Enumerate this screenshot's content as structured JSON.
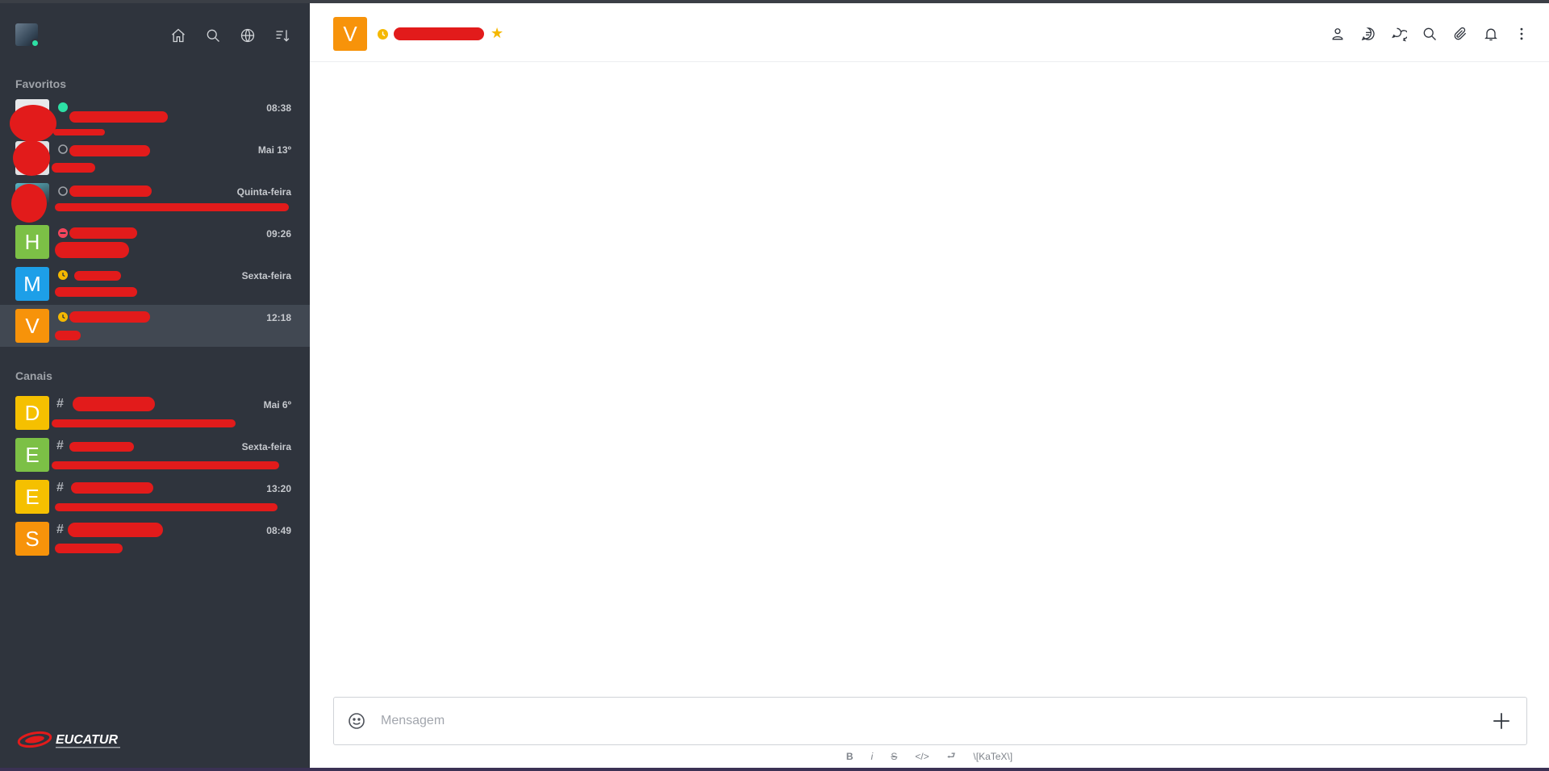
{
  "sidebar": {
    "tools": [
      {
        "icon": "home-icon"
      },
      {
        "icon": "search-icon"
      },
      {
        "icon": "directory-icon"
      },
      {
        "icon": "sort-icon"
      }
    ],
    "favorites_title": "Favoritos",
    "favorites": [
      {
        "avatar_letter": "",
        "status": "online",
        "name": "",
        "time": "08:38",
        "message": ""
      },
      {
        "avatar_letter": "",
        "status": "offline",
        "name": "",
        "time": "Mai 13º",
        "message": ""
      },
      {
        "avatar_letter": "",
        "status": "offline",
        "name": "",
        "time": "Quinta-feira",
        "message": ""
      },
      {
        "avatar_letter": "H",
        "status": "busy",
        "name": "",
        "time": "09:26",
        "message": ""
      },
      {
        "avatar_letter": "M",
        "status": "away",
        "name": "",
        "time": "Sexta-feira",
        "message": ""
      },
      {
        "avatar_letter": "V",
        "status": "away",
        "name": "",
        "time": "12:18",
        "message": ""
      }
    ],
    "channels_title": "Canais",
    "channels": [
      {
        "avatar_letter": "D",
        "name": "",
        "time": "Mai 6º",
        "message": ""
      },
      {
        "avatar_letter": "E",
        "name": "",
        "time": "Sexta-feira",
        "message": ""
      },
      {
        "avatar_letter": "E",
        "name": "",
        "time": "13:20",
        "message": ""
      },
      {
        "avatar_letter": "S",
        "name": "",
        "time": "08:49",
        "message": ""
      }
    ],
    "logo_text": "EUCATUR"
  },
  "room": {
    "avatar_letter": "V",
    "title": "",
    "header_tools": [
      {
        "icon": "user-info-icon"
      },
      {
        "icon": "discussion-icon"
      },
      {
        "icon": "threads-icon"
      },
      {
        "icon": "search-icon"
      },
      {
        "icon": "attachment-icon"
      },
      {
        "icon": "bell-icon"
      },
      {
        "icon": "kebab-menu-icon"
      }
    ]
  },
  "composer": {
    "placeholder": "Mensagem",
    "format": {
      "bold": "B",
      "italic": "i",
      "strike": "S",
      "code": "</>",
      "multiline": "⮐",
      "katex": "\\[KaTeX\\]"
    }
  },
  "colors": {
    "sidebar_bg": "#2f343d",
    "selected_row": "#414852",
    "online": "#2de0a5",
    "away": "#f5b800",
    "busy": "#f5455c",
    "offline": "#9ea2a8",
    "redaction": "#e21b1b"
  }
}
